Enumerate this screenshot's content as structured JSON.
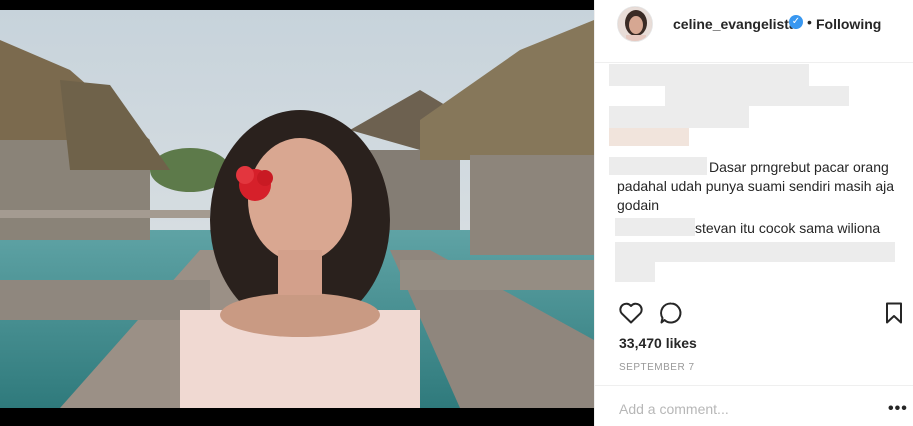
{
  "post": {
    "username": "celine_evangelista",
    "follow_status": "Following",
    "separator": "•",
    "likes": "33,470 likes",
    "date": "SEPTEMBER 7",
    "add_comment_placeholder": "Add a comment...",
    "more_label": "•••"
  },
  "comments": [
    {
      "text": "Dasar prngrebut pacar orang"
    },
    {
      "text": "padahal udah punya suami sendiri masih aja"
    },
    {
      "text": "godain"
    },
    {
      "text": "stevan itu cocok sama wiliona"
    }
  ],
  "icons": {
    "like": "heart-icon",
    "comment": "comment-icon",
    "save": "bookmark-icon",
    "verified": "verified-badge-icon"
  },
  "colors": {
    "verified": "#3897f0",
    "text": "#262626",
    "muted": "#999999"
  }
}
